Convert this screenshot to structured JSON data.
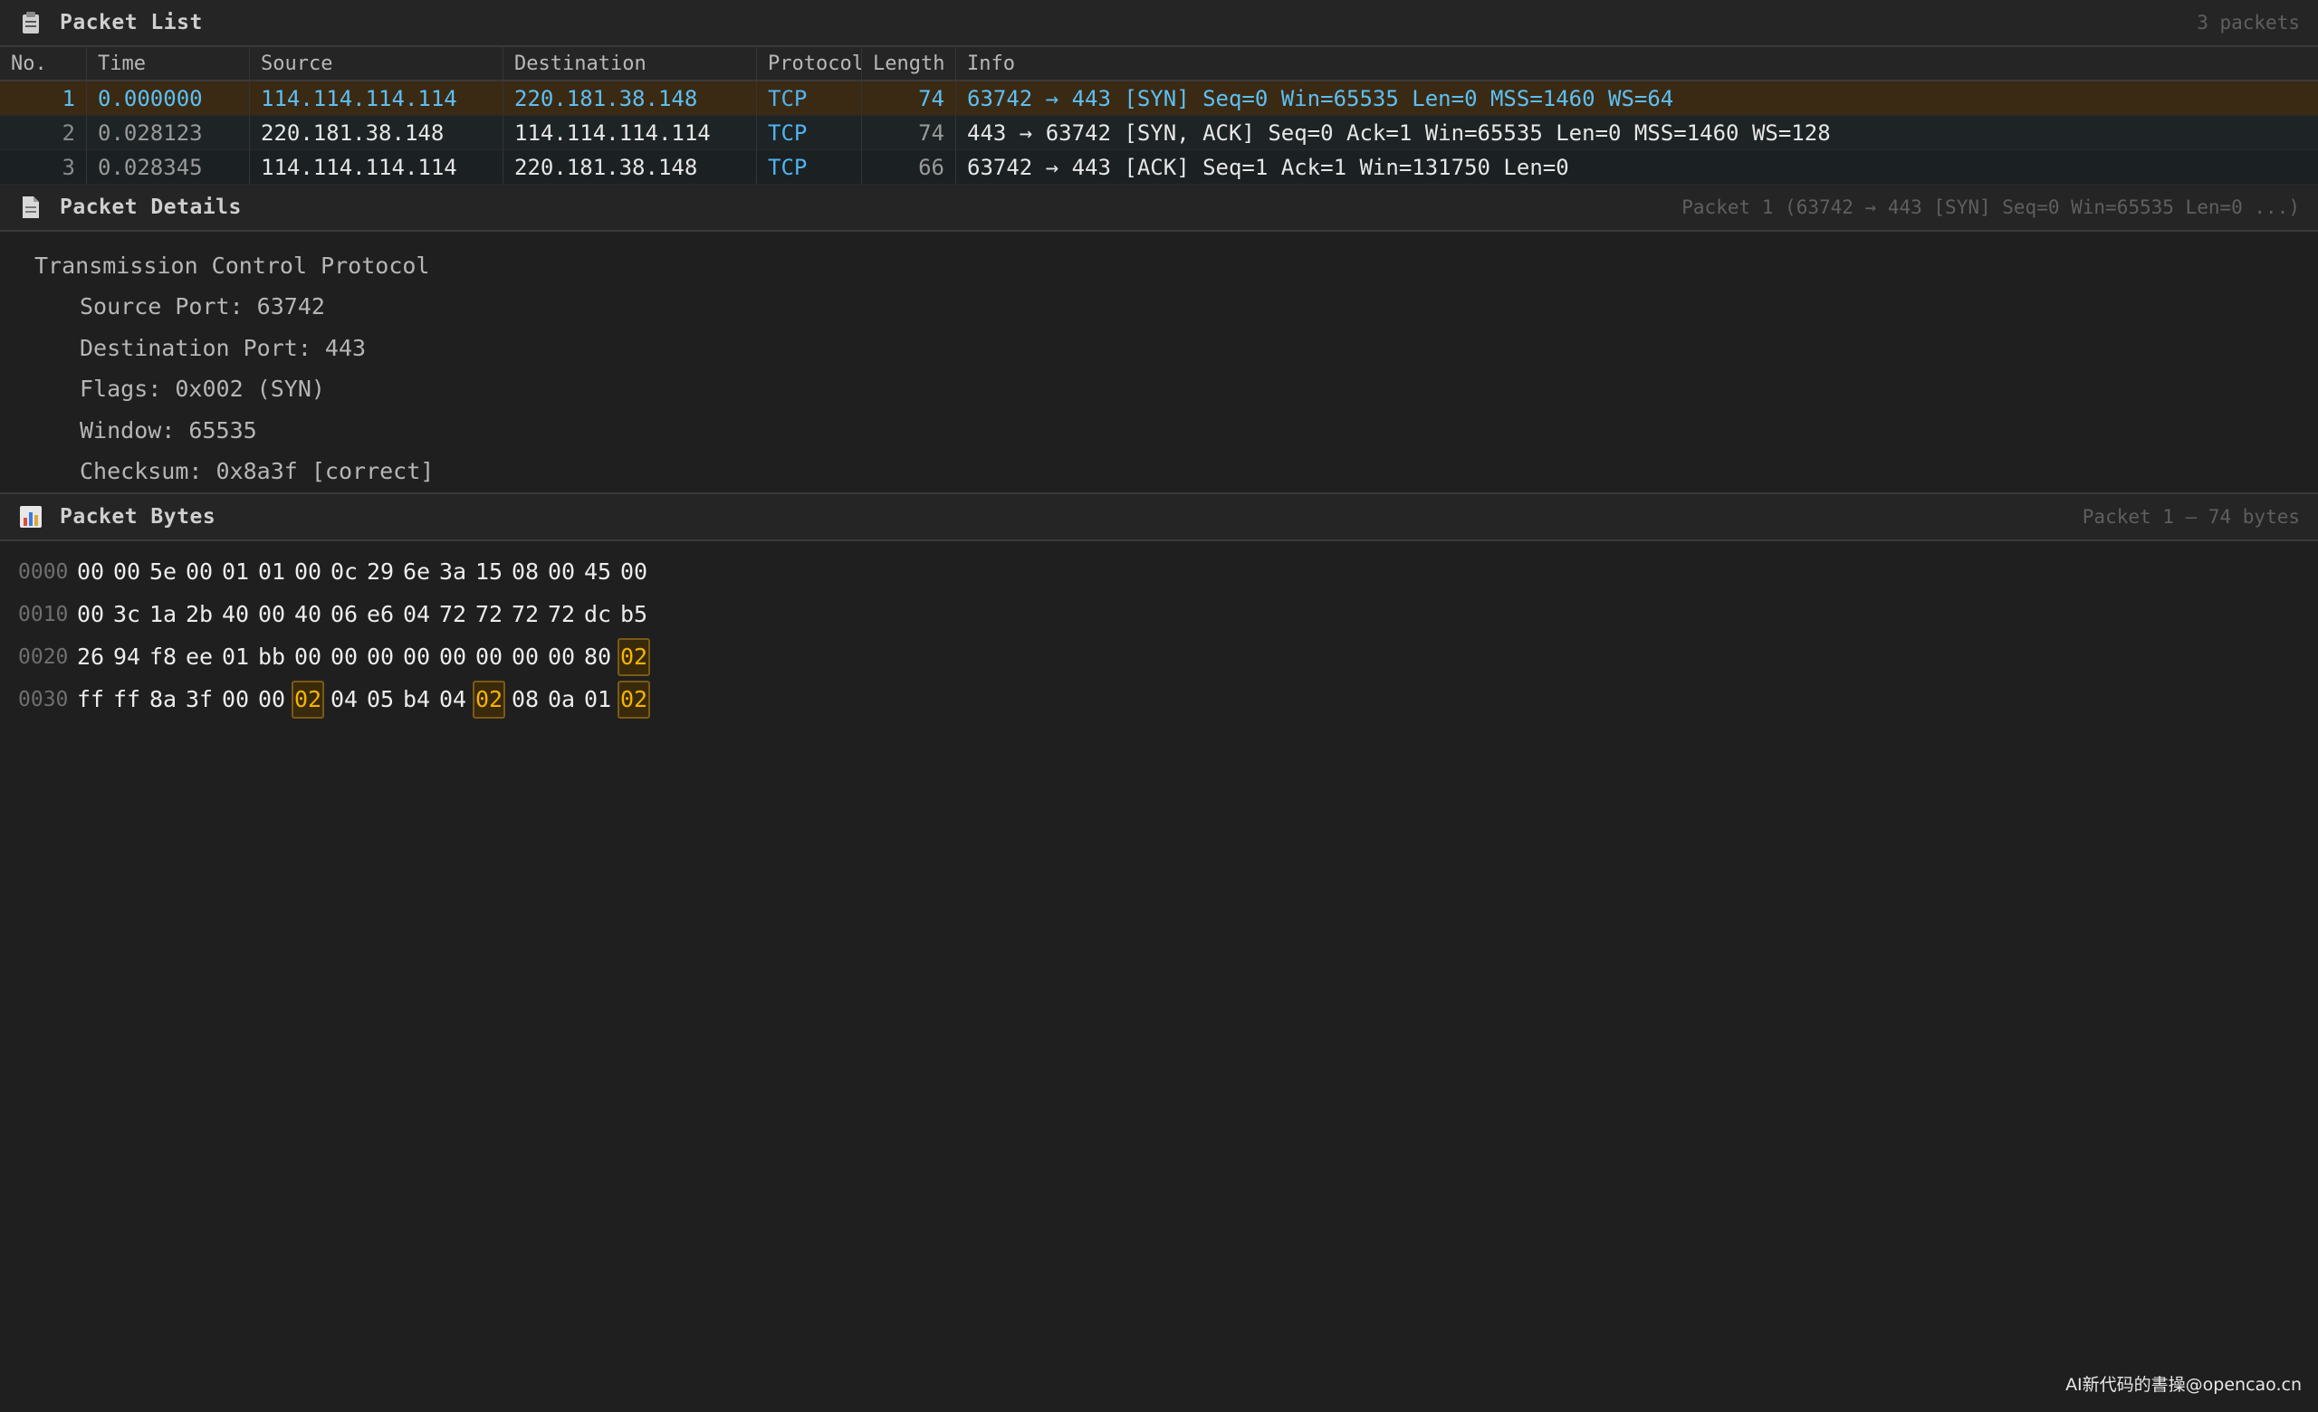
{
  "packet_list": {
    "title": "Packet List",
    "count_label": "3 packets",
    "columns": {
      "no": "No.",
      "time": "Time",
      "source": "Source",
      "destination": "Destination",
      "protocol": "Protocol",
      "length": "Length",
      "info": "Info"
    },
    "rows": [
      {
        "no": "1",
        "time": "0.000000",
        "source": "114.114.114.114",
        "destination": "220.181.38.148",
        "protocol": "TCP",
        "length": "74",
        "info": "63742 → 443 [SYN] Seq=0 Win=65535 Len=0 MSS=1460 WS=64"
      },
      {
        "no": "2",
        "time": "0.028123",
        "source": "220.181.38.148",
        "destination": "114.114.114.114",
        "protocol": "TCP",
        "length": "74",
        "info": "443 → 63742 [SYN, ACK] Seq=0 Ack=1 Win=65535 Len=0 MSS=1460 WS=128"
      },
      {
        "no": "3",
        "time": "0.028345",
        "source": "114.114.114.114",
        "destination": "220.181.38.148",
        "protocol": "TCP",
        "length": "66",
        "info": "63742 → 443 [ACK] Seq=1 Ack=1 Win=131750 Len=0"
      }
    ],
    "selected_row": 0
  },
  "packet_details": {
    "title": "Packet Details",
    "summary": "Packet 1 (63742 → 443 [SYN] Seq=0 Win=65535 Len=0 ...)",
    "root": "Transmission Control Protocol",
    "fields": [
      "Source Port: 63742",
      "Destination Port: 443",
      "Flags: 0x002 (SYN)",
      "Window: 65535",
      "Checksum: 0x8a3f [correct]"
    ]
  },
  "packet_bytes": {
    "title": "Packet Bytes",
    "summary": "Packet 1 — 74 bytes",
    "rows": [
      {
        "offset": "0000",
        "bytes": [
          "00",
          "00",
          "5e",
          "00",
          "01",
          "01",
          "00",
          "0c",
          "29",
          "6e",
          "3a",
          "15",
          "08",
          "00",
          "45",
          "00"
        ],
        "highlight": []
      },
      {
        "offset": "0010",
        "bytes": [
          "00",
          "3c",
          "1a",
          "2b",
          "40",
          "00",
          "40",
          "06",
          "e6",
          "04",
          "72",
          "72",
          "72",
          "72",
          "dc",
          "b5"
        ],
        "highlight": []
      },
      {
        "offset": "0020",
        "bytes": [
          "26",
          "94",
          "f8",
          "ee",
          "01",
          "bb",
          "00",
          "00",
          "00",
          "00",
          "00",
          "00",
          "00",
          "00",
          "80",
          "02"
        ],
        "highlight": [
          15
        ]
      },
      {
        "offset": "0030",
        "bytes": [
          "ff",
          "ff",
          "8a",
          "3f",
          "00",
          "00",
          "02",
          "04",
          "05",
          "b4",
          "04",
          "02",
          "08",
          "0a",
          "01",
          "02"
        ],
        "highlight": [
          6,
          11,
          15
        ]
      }
    ]
  },
  "icons": {
    "packet_list": "clipboard-icon",
    "packet_details": "document-icon",
    "packet_bytes": "bar-chart-icon"
  },
  "colors": {
    "accent_blue": "#4fb3f0",
    "selected_row_bg": "#3a2a14",
    "highlight_byte": "#f5b400"
  },
  "watermark": "AI新代码的書操@opencao.cn"
}
